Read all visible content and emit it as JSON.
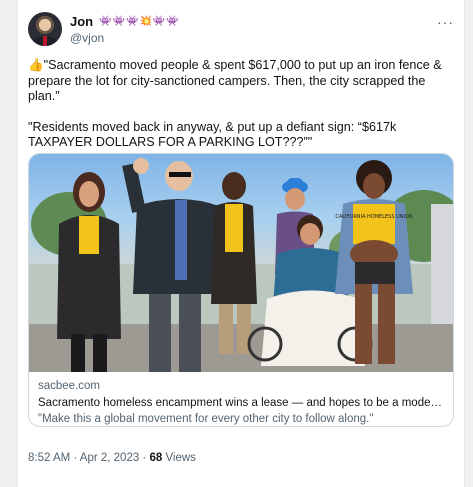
{
  "tweet": {
    "author_name": "Jon",
    "author_emojis": "👾👾👾💥👾👾",
    "handle": "@vjon",
    "more": "···",
    "paragraph1": "👍\"Sacramento moved people & spent $617,000 to put up an iron fence & prepare the lot for city-sanctioned campers. Then, the city scrapped the plan.\"",
    "paragraph2": "\"Residents moved back in anyway, & put up a defiant sign: “$617k TAXPAYER DOLLARS FOR A PARKING LOT???”\""
  },
  "link_card": {
    "domain": "sacbee.com",
    "headline": "Sacramento homeless encampment wins a lease — and hopes to be a model for California",
    "description": "\"Make this a global movement for every other city to follow along.\""
  },
  "meta": {
    "time": "8:52 AM · Apr 2, 2023 · ",
    "views_count": "68",
    "views_label": " Views"
  },
  "shirt_text": "CALIFORNIA HOMELESS UNION"
}
